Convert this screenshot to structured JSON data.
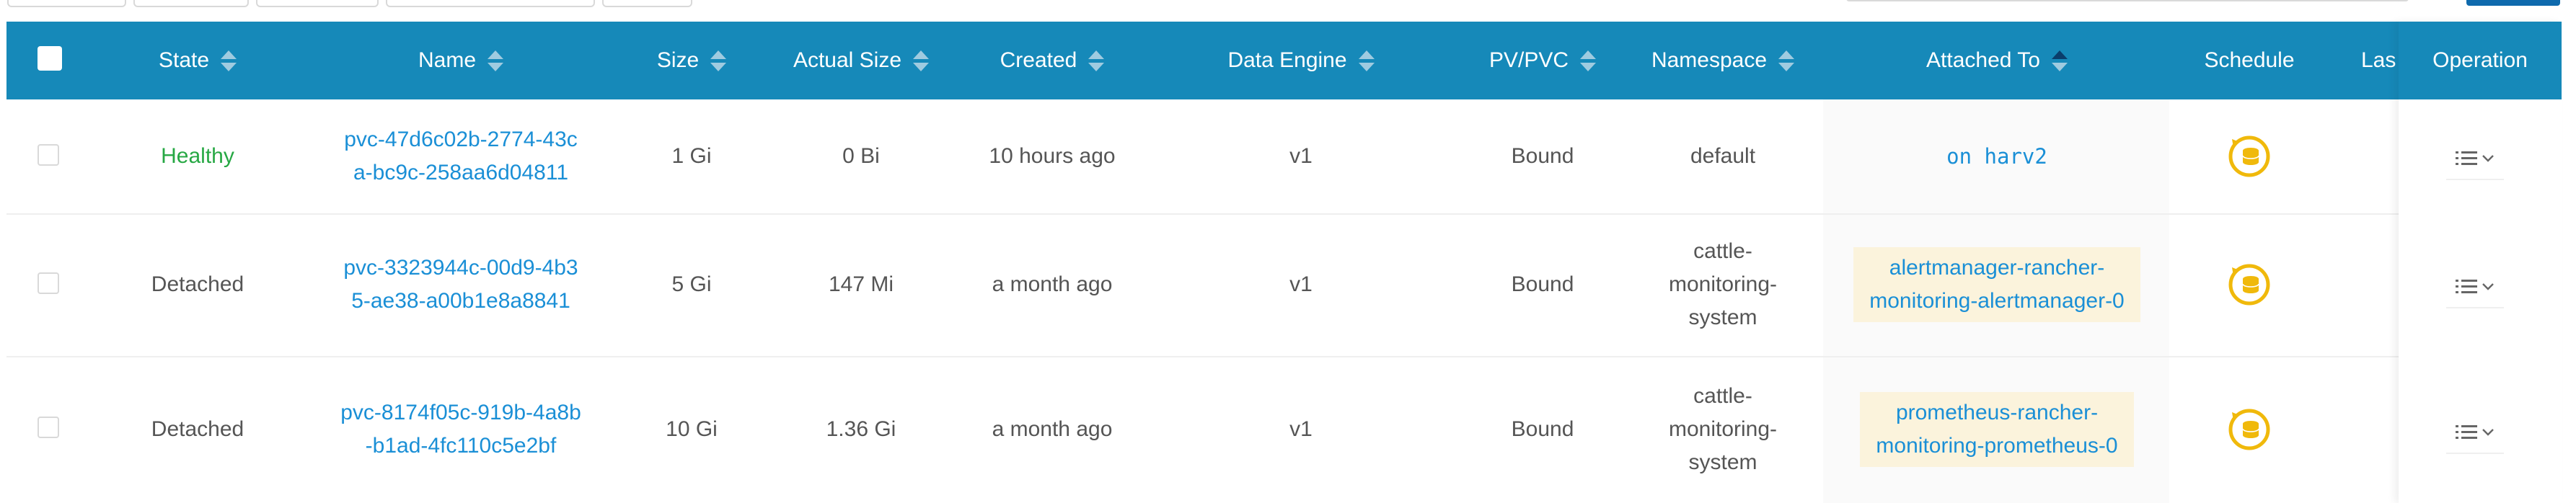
{
  "header": {
    "state": "State",
    "name": "Name",
    "size": "Size",
    "actual_size": "Actual Size",
    "created": "Created",
    "data_engine": "Data Engine",
    "pvpvc": "PV/PVC",
    "namespace": "Namespace",
    "attached_to": "Attached To",
    "schedule": "Schedule",
    "last": "Las",
    "operation": "Operation"
  },
  "rows": [
    {
      "state": "Healthy",
      "name_line1": "pvc-47d6c02b-2774-43c",
      "name_line2": "a-bc9c-258aa6d04811",
      "size": "1 Gi",
      "actual_size": "0 Bi",
      "created": "10 hours ago",
      "data_engine": "v1",
      "pvpvc": "Bound",
      "namespace_line1": "default",
      "namespace_line2": "",
      "namespace_line3": "",
      "attached_line1": "on harv2",
      "attached_line2": ""
    },
    {
      "state": "Detached",
      "name_line1": "pvc-3323944c-00d9-4b3",
      "name_line2": "5-ae38-a00b1e8a8841",
      "size": "5 Gi",
      "actual_size": "147 Mi",
      "created": "a month ago",
      "data_engine": "v1",
      "pvpvc": "Bound",
      "namespace_line1": "cattle-",
      "namespace_line2": "monitoring-",
      "namespace_line3": "system",
      "attached_line1": "alertmanager-rancher-",
      "attached_line2": "monitoring-alertmanager-0"
    },
    {
      "state": "Detached",
      "name_line1": "pvc-8174f05c-919b-4a8b",
      "name_line2": "-b1ad-4fc110c5e2bf",
      "size": "10 Gi",
      "actual_size": "1.36 Gi",
      "created": "a month ago",
      "data_engine": "v1",
      "pvpvc": "Bound",
      "namespace_line1": "cattle-",
      "namespace_line2": "monitoring-",
      "namespace_line3": "system",
      "attached_line1": "prometheus-rancher-",
      "attached_line2": "monitoring-prometheus-0"
    }
  ],
  "icons": {
    "schedule": "schedule-recurring-icon",
    "operation": "list-menu-icon",
    "chevron": "chevron-down-icon"
  },
  "colors": {
    "header_bg": "#1689b9",
    "link": "#1a8fd6",
    "healthy": "#27a844",
    "chip_bg": "#fbf3dc",
    "schedule_icon": "#f0b90b"
  }
}
